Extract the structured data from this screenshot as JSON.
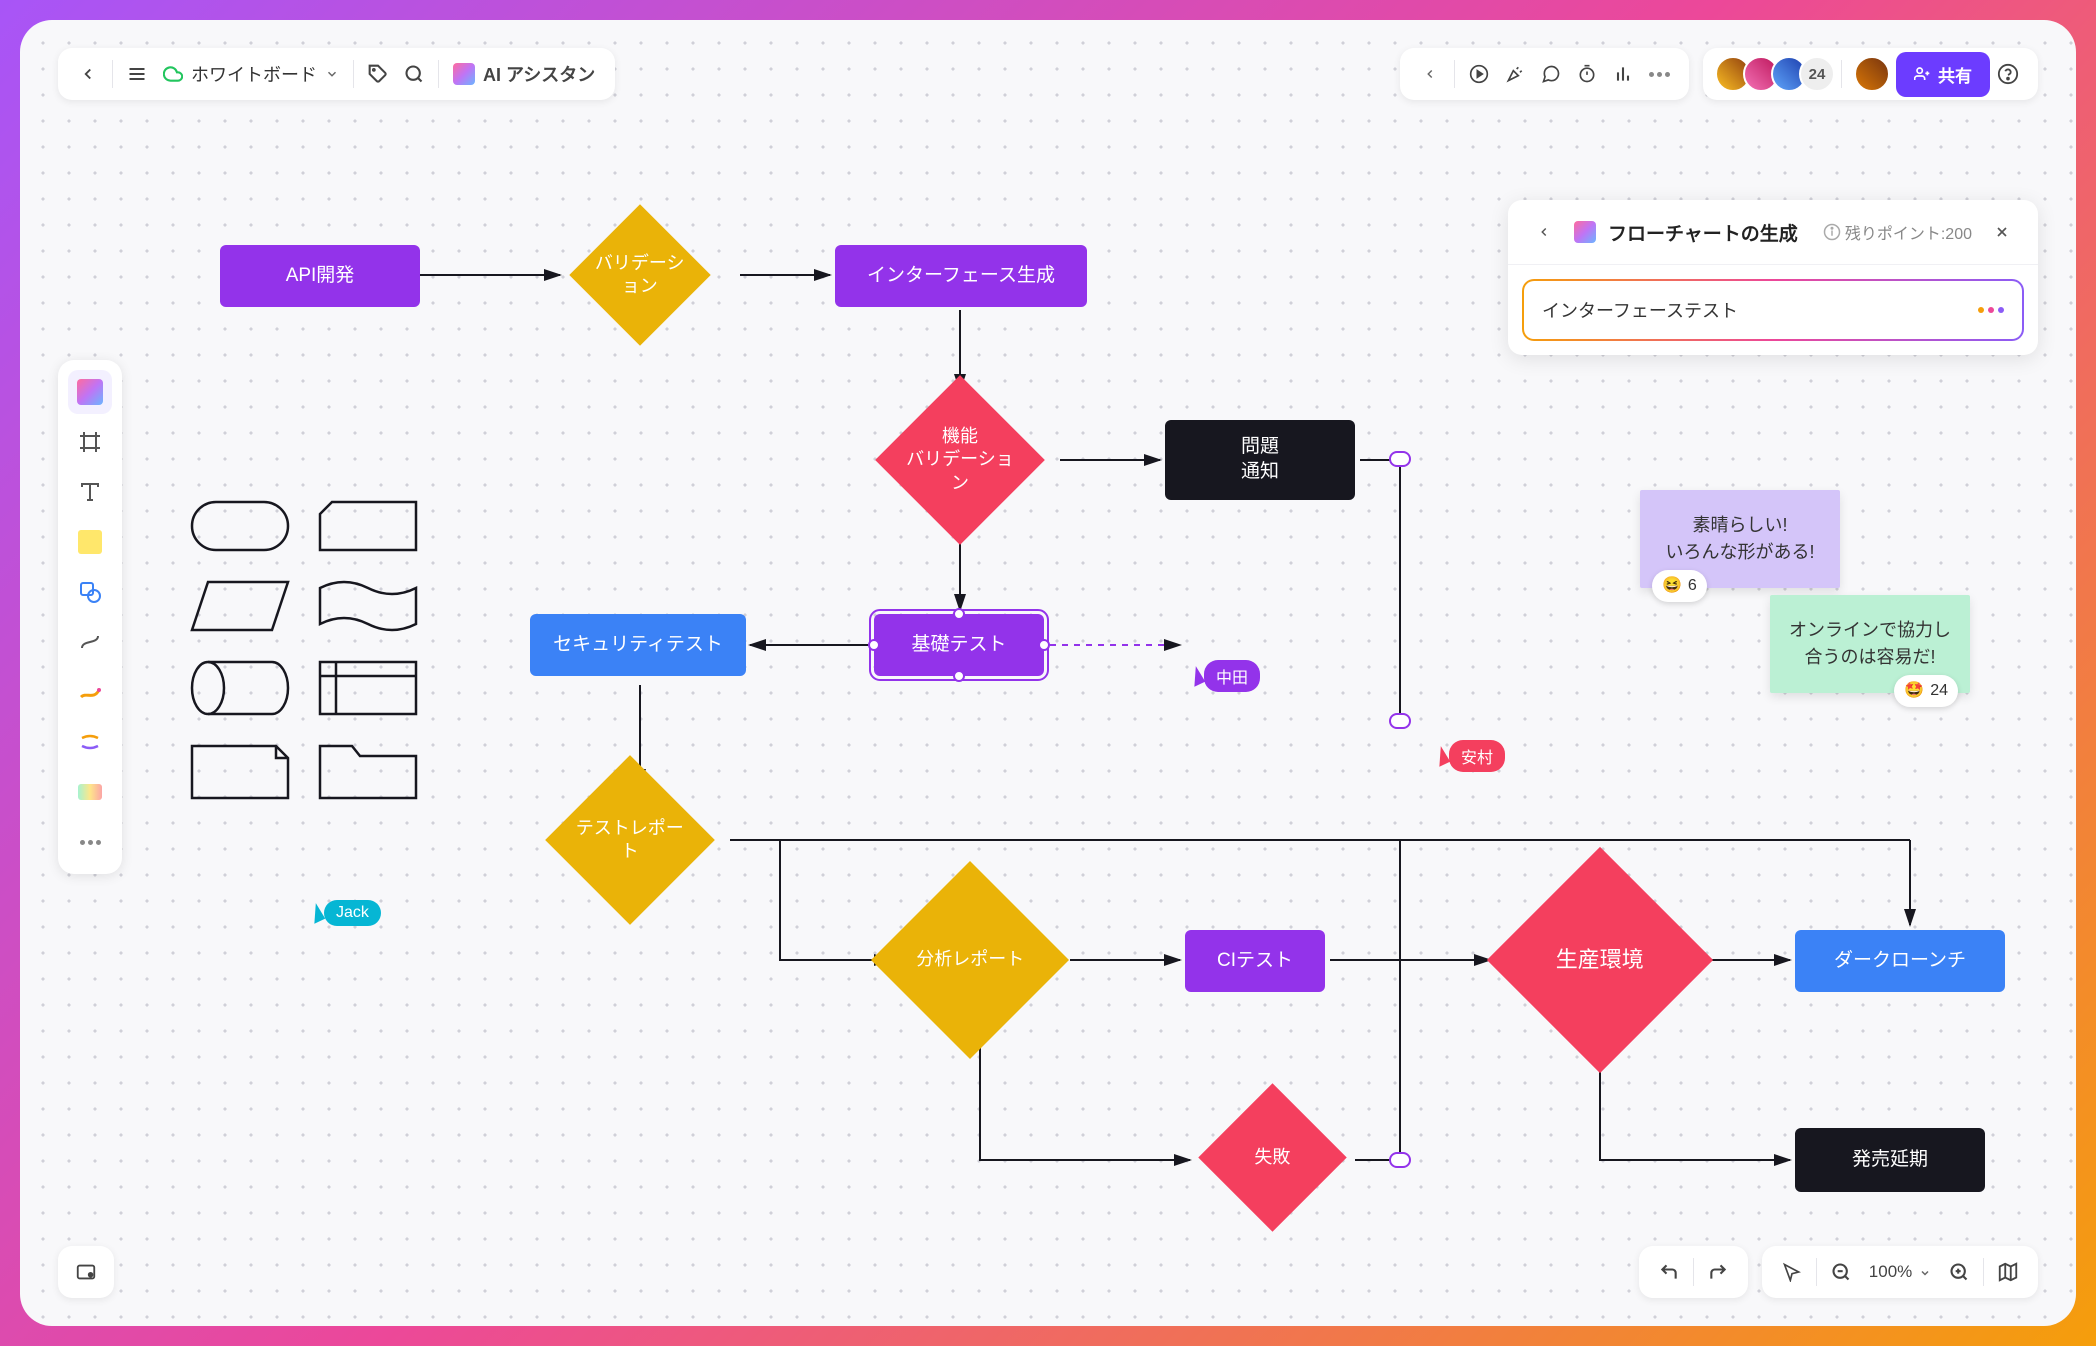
{
  "toolbar": {
    "board_name": "ホワイトボード",
    "ai_label": "AI アシスタン",
    "avatar_count": "24",
    "share_label": "共有",
    "zoom_label": "100%"
  },
  "nodes": {
    "api_dev": "API開発",
    "validation": "バリデーション",
    "interface_gen": "インターフェース生成",
    "func_validation_l1": "機能",
    "func_validation_l2": "バリデーション",
    "issue_l1": "問題",
    "issue_l2": "通知",
    "security_test": "セキュリティテスト",
    "basic_test": "基礎テスト",
    "test_report": "テストレポート",
    "analysis_report": "分析レポート",
    "ci_test": "CIテスト",
    "prod_env": "生産環境",
    "dark_launch": "ダークローンチ",
    "failure": "失敗",
    "release_delay": "発売延期"
  },
  "cursors": {
    "jack": "Jack",
    "nakata": "中田",
    "yasumura": "安村"
  },
  "sticky": {
    "note1_l1": "素晴らしい!",
    "note1_l2": "いろんな形がある!",
    "note2_l1": "オンラインで協力し",
    "note2_l2": "合うのは容易だ!",
    "reaction1_count": "6",
    "reaction2_count": "24"
  },
  "ai_panel": {
    "title": "フローチャートの生成",
    "hint": "残りポイント:200",
    "input_value": "インターフェーステスト"
  }
}
